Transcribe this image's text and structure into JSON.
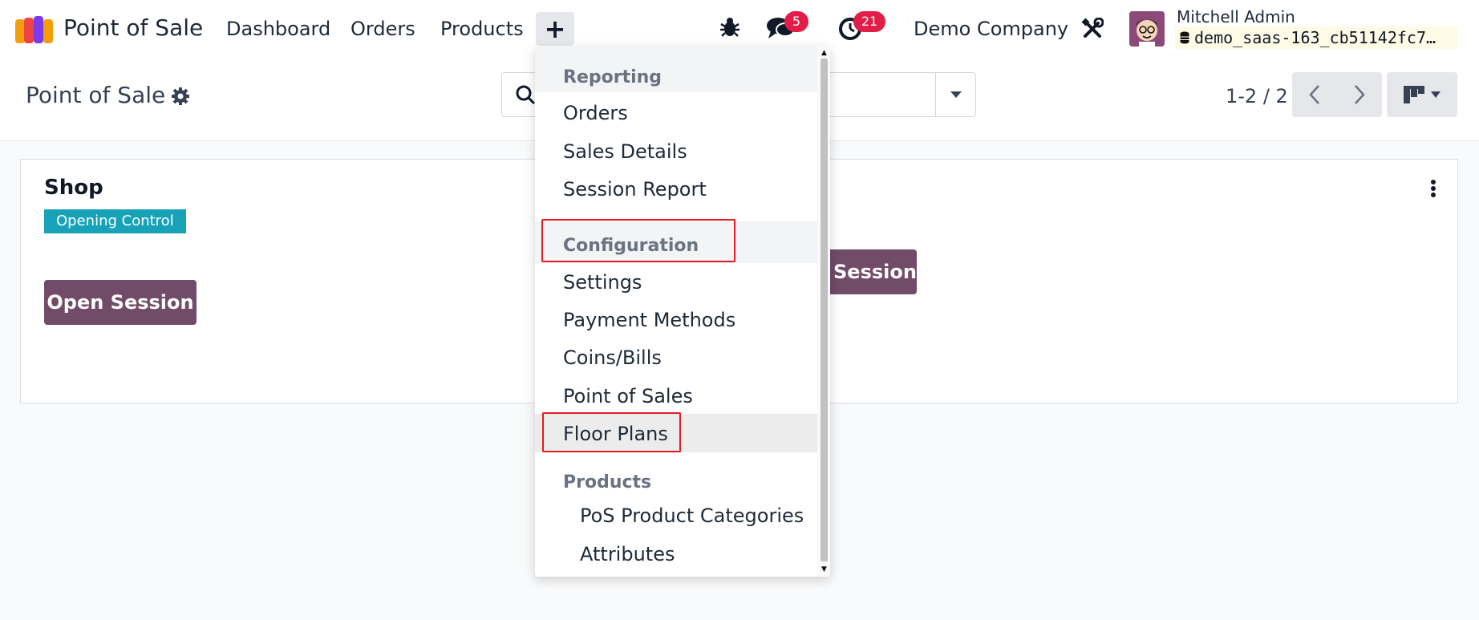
{
  "navbar": {
    "app_title": "Point of Sale",
    "menu": [
      "Dashboard",
      "Orders",
      "Products"
    ],
    "quick_create_symbol": "+",
    "debug_icon": "bug-icon",
    "messages_count": "5",
    "activities_count": "21",
    "company": "Demo Company",
    "user_name": "Mitchell Admin",
    "database": "demo_saas-163_cb51142fc7…"
  },
  "control_panel": {
    "title": "Point of Sale",
    "pager": "1-2 / 2"
  },
  "card": {
    "title": "Shop",
    "status": "Opening Control",
    "primary_action": "Open Session",
    "second_card_action": "Session"
  },
  "dropdown": {
    "sections": [
      {
        "header": "Reporting",
        "items": [
          "Orders",
          "Sales Details",
          "Session Report"
        ]
      },
      {
        "header": "Configuration",
        "items": [
          "Settings",
          "Payment Methods",
          "Coins/Bills",
          "Point of Sales",
          "Floor Plans"
        ]
      },
      {
        "header": "Products",
        "items": [
          "PoS Product Categories",
          "Attributes"
        ]
      }
    ],
    "hovered_item": "Floor Plans",
    "highlighted": [
      "Configuration",
      "Floor Plans"
    ]
  },
  "colors": {
    "brand_purple": "#714b67",
    "badge_red": "#e11d48",
    "status_teal": "#17a2b8",
    "highlight_red": "#e11d28"
  }
}
